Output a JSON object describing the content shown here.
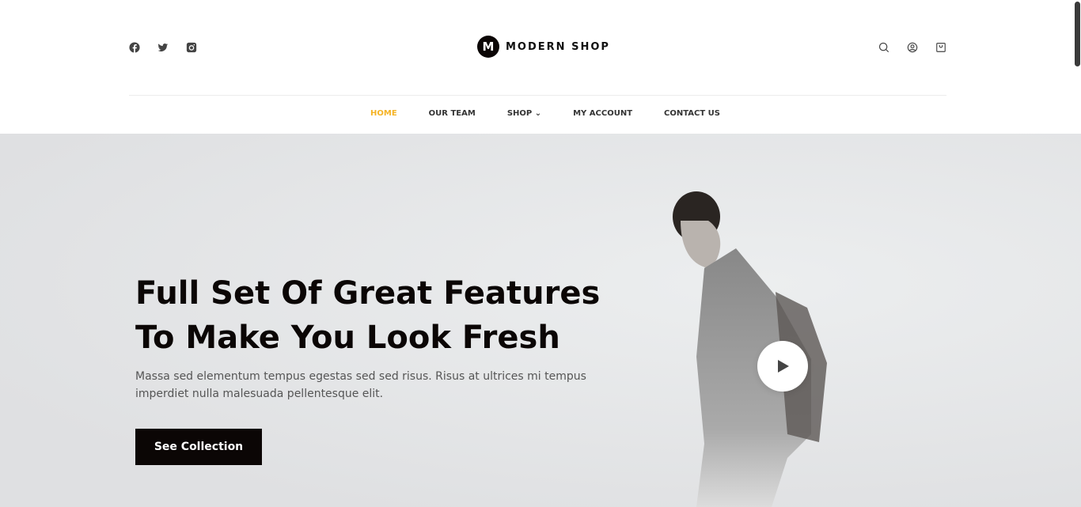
{
  "header": {
    "social": [
      "facebook-icon",
      "twitter-icon",
      "instagram-icon"
    ],
    "logo_letter": "M",
    "brand": "MODERN SHOP",
    "tools": [
      "search-icon",
      "user-icon",
      "cart-icon"
    ]
  },
  "nav": {
    "items": [
      {
        "label": "HOME",
        "active": true
      },
      {
        "label": "OUR TEAM"
      },
      {
        "label": "SHOP",
        "has_dropdown": true
      },
      {
        "label": "MY ACCOUNT"
      },
      {
        "label": "CONTACT US"
      }
    ]
  },
  "hero": {
    "title_line1": "Full Set Of Great Features",
    "title_line2": "To Make You Look Fresh",
    "subtitle": "Massa sed elementum tempus egestas sed sed risus. Risus at ultrices mi tempus imperdiet nulla malesuada pellentesque elit.",
    "cta": "See Collection"
  },
  "colors": {
    "accent": "#f5b325",
    "dark": "#0b0605"
  }
}
